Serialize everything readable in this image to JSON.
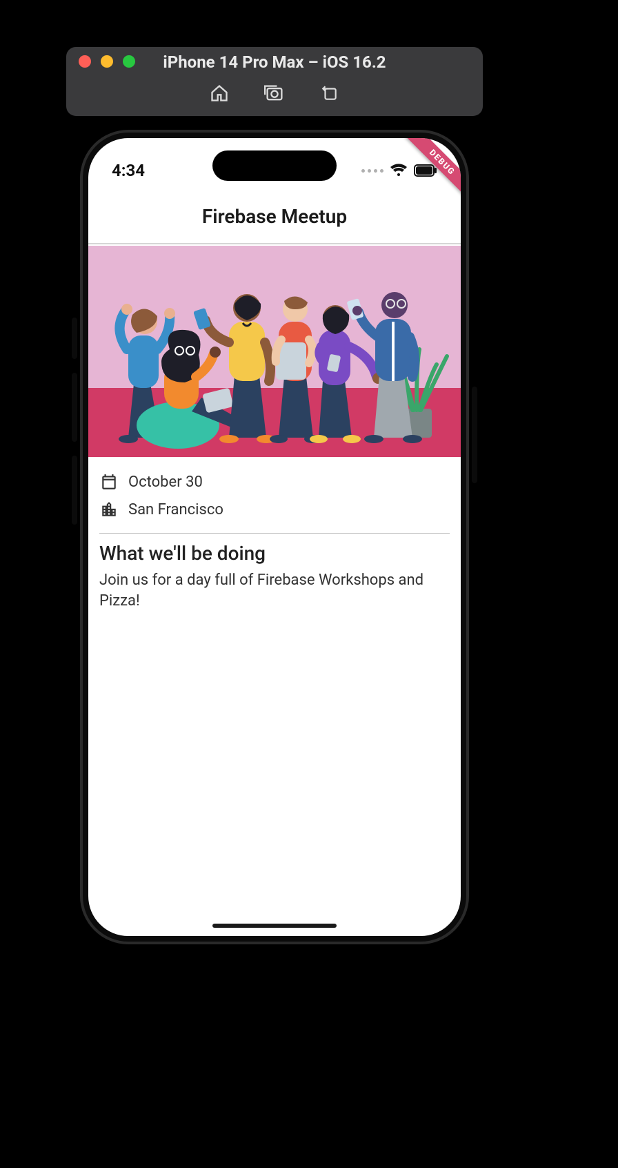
{
  "window": {
    "title": "iPhone 14 Pro Max – iOS 16.2"
  },
  "statusbar": {
    "time": "4:34"
  },
  "app": {
    "title": "Firebase Meetup",
    "debug_banner": "DEBUG",
    "date": "October 30",
    "location": "San Francisco",
    "section_heading": "What we'll be doing",
    "section_body": "Join us for a day full of Firebase Workshops and Pizza!"
  }
}
